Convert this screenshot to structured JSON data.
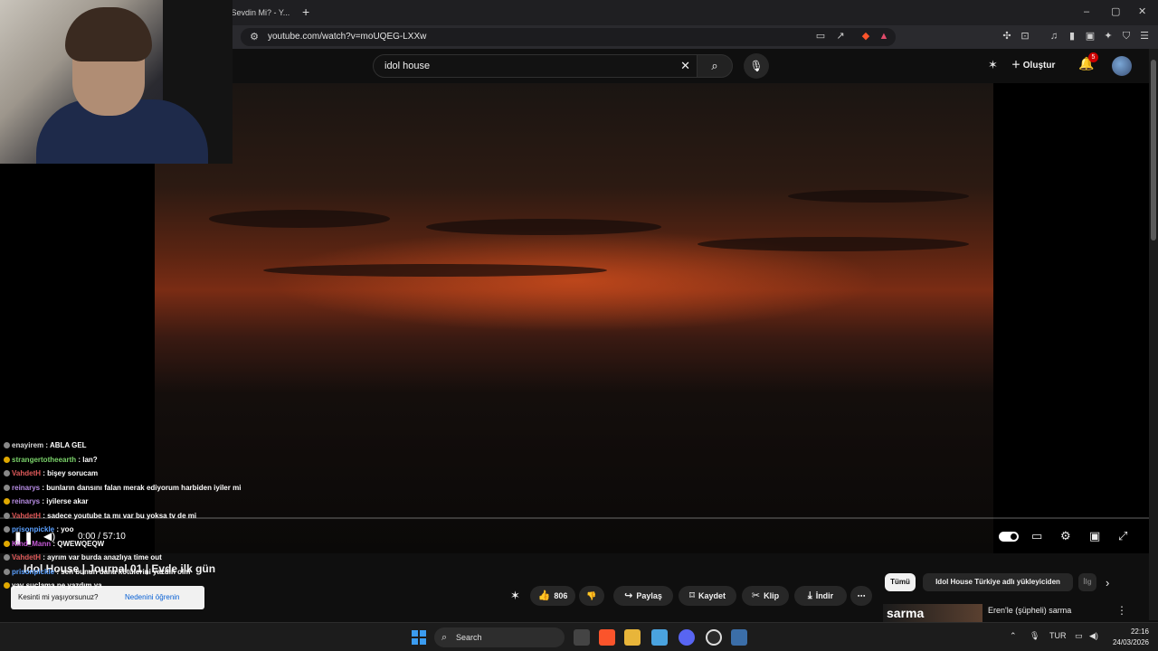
{
  "browser": {
    "tab_title": "İç Sevdin Mi? - Y...",
    "new_tab": "+",
    "url": "youtube.com/watch?v=moUQEG-LXXw",
    "window_controls": {
      "minimize": "–",
      "maximize": "▢",
      "close": "✕"
    }
  },
  "youtube": {
    "search": {
      "value": "idol house",
      "clear": "✕",
      "search_icon": "search-icon",
      "mic_icon": "mic-icon"
    },
    "create_label": "Oluştur",
    "notifications_count": "5"
  },
  "player": {
    "current_time": "0:00",
    "duration": "57:10",
    "time_display": "0:00 / 57:10",
    "paused": true,
    "autoplay_on": true
  },
  "video": {
    "title": "Idol House | Journal 01 | Evde ilk gün",
    "tooltip_question": "Kesinti mi yaşıyorsunuz?",
    "tooltip_link": "Nedenini öğrenin",
    "actions": {
      "like_count": "806",
      "share": "Paylaş",
      "save": "Kaydet",
      "clip": "Klip",
      "download": "İndir"
    }
  },
  "recommendations": {
    "chips": [
      "Tümü",
      "Idol House Türkiye adlı yükleyiciden",
      "İlg"
    ],
    "items": [
      {
        "thumb_text": "sarma",
        "title": "Eren'le (şüpheli) sarma"
      }
    ]
  },
  "chat": {
    "messages": [
      {
        "user": "enayirem",
        "text": "ABLA GEL",
        "color": "#dcdcdc"
      },
      {
        "user": "strangertotheearth",
        "text": "lan?",
        "color": "#7bd36a"
      },
      {
        "user": "VahdetH",
        "text": "bişey sorucam",
        "color": "#e05a5a"
      },
      {
        "user": "reinarys",
        "text": "bunların dansını falan merak ediyorum harbiden iyiler mi",
        "color": "#b98ee6"
      },
      {
        "user": "reinarys",
        "text": "iyilerse akar",
        "color": "#b98ee6"
      },
      {
        "user": "VahdetH",
        "text": "sadece youtube ta mı var bu yoksa tv de mi",
        "color": "#e05a5a"
      },
      {
        "user": "prisonpickle",
        "text": "yoo",
        "color": "#5aa0ff"
      },
      {
        "user": "Kind_Mann",
        "text": "QWEWQEQW",
        "color": "#c75ad8"
      },
      {
        "user": "VahdetH",
        "text": "ayrım var burda anazlıya time out",
        "color": "#e05a5a"
      },
      {
        "user": "prisonpickle",
        "text": "sen bunun daha kötülerini yazdın olm",
        "color": "#5aa0ff"
      },
      {
        "user": "",
        "text": "yav suçlama ne yazdım ya",
        "color": "#dcdcdc"
      }
    ]
  },
  "taskbar": {
    "search_label": "Search",
    "language": "TUR",
    "time": "22:16",
    "date": "24/03/2026"
  }
}
